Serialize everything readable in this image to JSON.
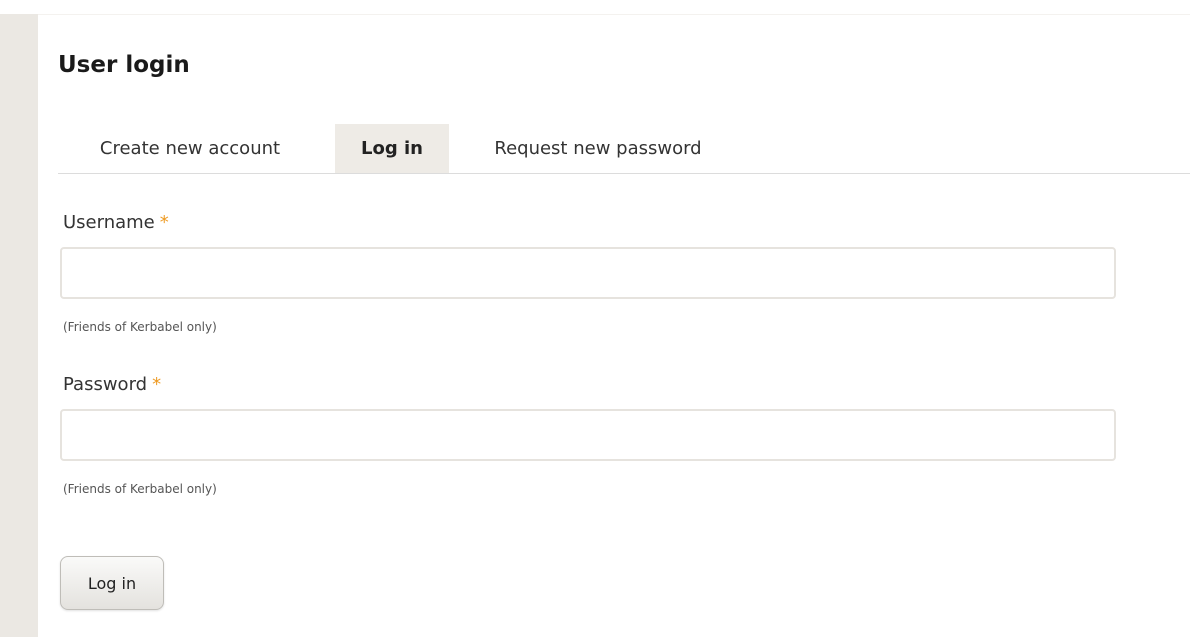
{
  "page": {
    "title": "User login"
  },
  "tabs": [
    {
      "label": "Create new account",
      "active": false
    },
    {
      "label": "Log in",
      "active": true
    },
    {
      "label": "Request new password",
      "active": false
    }
  ],
  "form": {
    "username": {
      "label": "Username",
      "required_marker": "*",
      "value": "",
      "description": "(Friends of Kerbabel only)"
    },
    "password": {
      "label": "Password",
      "required_marker": "*",
      "value": "",
      "description": "(Friends of Kerbabel only)"
    },
    "submit_label": "Log in"
  },
  "colors": {
    "required": "#ee9a22",
    "active_tab_bg": "#eeebe6",
    "sidebar": "#ebe8e3"
  }
}
